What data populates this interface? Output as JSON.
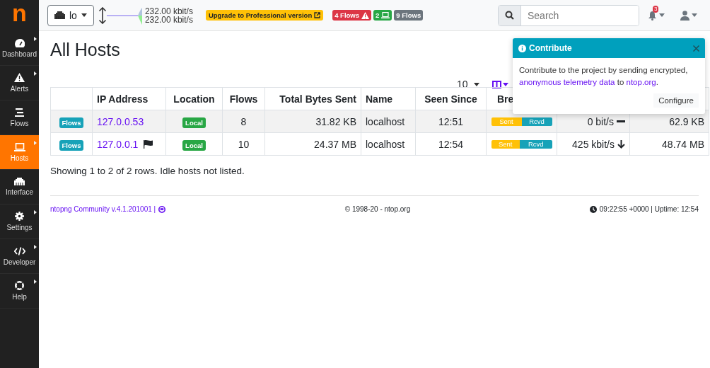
{
  "logo": "n",
  "topbar": {
    "interface": "lo",
    "upload_rate": "232.00 kbit/s",
    "download_rate": "232.00 kbit/s",
    "upgrade": "Upgrade to Professional version",
    "badges": [
      {
        "text": "4 Flows",
        "kind": "alert",
        "color": "#dc3545"
      },
      {
        "text": "2",
        "kind": "hosts",
        "color": "#28a745"
      },
      {
        "text": "9 Flows",
        "kind": "plain",
        "color": "#6c757d"
      }
    ],
    "search": {
      "placeholder": "Search"
    },
    "notifications": "3"
  },
  "sidebar": {
    "items": [
      {
        "label": "Dashboard",
        "kind": "dashboard",
        "submenu": true,
        "selected": false
      },
      {
        "label": "Alerts",
        "kind": "alerts",
        "submenu": true,
        "selected": false
      },
      {
        "label": "Flows",
        "kind": "flows",
        "submenu": false,
        "selected": false
      },
      {
        "label": "Hosts",
        "kind": "hosts",
        "submenu": true,
        "selected": true
      },
      {
        "label": "Interface",
        "kind": "interface",
        "submenu": false,
        "selected": false
      },
      {
        "label": "Settings",
        "kind": "settings",
        "submenu": true,
        "selected": false
      },
      {
        "label": "Developer",
        "kind": "developer",
        "submenu": true,
        "selected": false
      },
      {
        "label": "Help",
        "kind": "help",
        "submenu": true,
        "selected": false
      }
    ]
  },
  "page": {
    "title": "All Hosts",
    "page_size": "10",
    "table": {
      "headers": [
        "IP Address",
        "Location",
        "Flows",
        "Total Bytes Sent",
        "Name",
        "Seen Since",
        "Bre"
      ],
      "rows": [
        {
          "flows_button": "Flows",
          "ip": "127.0.0.53",
          "flagged": false,
          "location": "Local",
          "flows": "8",
          "bytes_sent": "31.82 KB",
          "name": "localhost",
          "seen_since": "12:51",
          "sent": "Sent",
          "rcvd": "Rcvd",
          "level": 0.5,
          "throughput": "0 bit/s",
          "kind": "flat",
          "total": "62.9 KB"
        },
        {
          "flows_button": "Flows",
          "ip": "127.0.0.1",
          "flagged": true,
          "location": "Local",
          "flows": "10",
          "bytes_sent": "24.37 MB",
          "name": "localhost",
          "seen_since": "12:54",
          "sent": "Sent",
          "rcvd": "Rcvd",
          "level": 0.47,
          "throughput": "425 kbit/s",
          "kind": "down",
          "total": "48.74 MB"
        }
      ]
    },
    "summary": "Showing 1 to 2 of 2 rows. Idle hosts not listed."
  },
  "footer": {
    "version": "ntopng Community v.4.1.201001 |",
    "copyright": "© 1998-20 - ntop.org",
    "clock": "09:22:55 +0000 | Uptime: 12:54"
  },
  "popup": {
    "title": "Contribute",
    "body": [
      {
        "text": "Contribute to the project by sending encrypted,",
        "link": false
      },
      {
        "text": "anonymous telemetry data",
        "link": true
      },
      {
        "text": "to",
        "link": false
      },
      {
        "text": "ntop.org",
        "link": true
      },
      {
        "text": ".",
        "link": false
      }
    ],
    "button": "Configure"
  }
}
